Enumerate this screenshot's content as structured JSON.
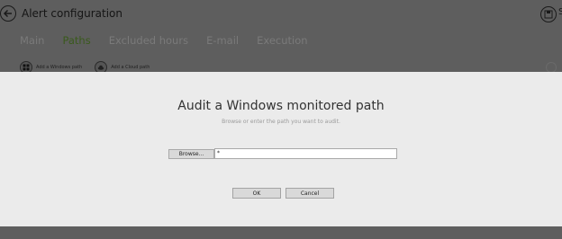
{
  "header": {
    "title": "Alert configuration",
    "save_label": "S"
  },
  "tabs": [
    {
      "label": "Main",
      "active": false
    },
    {
      "label": "Paths",
      "active": true
    },
    {
      "label": "Excluded hours",
      "active": false
    },
    {
      "label": "E-mail",
      "active": false
    },
    {
      "label": "Execution",
      "active": false
    }
  ],
  "toolbar": {
    "add_windows_path": "Add a Windows path",
    "add_cloud_path": "Add a Cloud path"
  },
  "dialog": {
    "title": "Audit a Windows monitored path",
    "subtitle": "Browse or enter the path you want to audit.",
    "browse_label": "Browse...",
    "path_value": "*",
    "ok_label": "OK",
    "cancel_label": "Cancel"
  },
  "colors": {
    "overlay_bg": "#5e5e5e",
    "dialog_bg": "#ebebeb",
    "active_tab": "#3a5a1c"
  }
}
